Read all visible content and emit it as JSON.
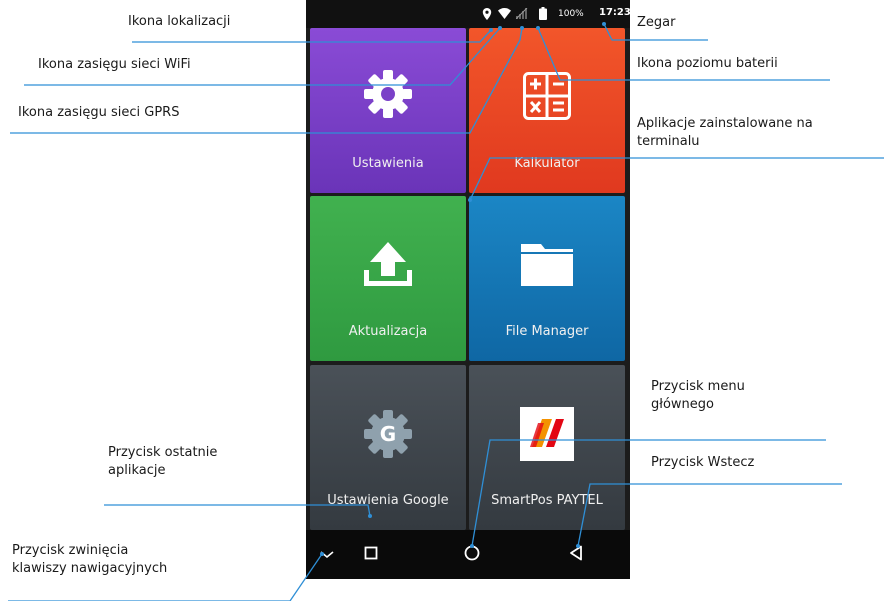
{
  "status_bar": {
    "battery_percent": "100%",
    "clock": "17:23",
    "icons": [
      "location-icon",
      "wifi-icon",
      "signal-icon",
      "battery-icon"
    ]
  },
  "apps": [
    {
      "label": "Ustawienia",
      "icon": "gear-icon",
      "color": "#7b3fc4"
    },
    {
      "label": "Kalkulator",
      "icon": "calculator-icon",
      "color": "#ee4a26"
    },
    {
      "label": "Aktualizacja",
      "icon": "upload-icon",
      "color": "#3aa548"
    },
    {
      "label": "File Manager",
      "icon": "folder-icon",
      "color": "#1677b6"
    },
    {
      "label": "Ustawienia Google",
      "icon": "google-settings-icon",
      "color": "#3a4148"
    },
    {
      "label": "SmartPos PAYTEL",
      "icon": "paytel-icon",
      "color": "#3a4148"
    }
  ],
  "nav_bar": {
    "icons": [
      "collapse-icon",
      "recents-icon",
      "home-icon",
      "back-icon"
    ]
  },
  "annotations": {
    "location": "Ikona lokalizacji",
    "wifi": "Ikona zasięgu sieci WiFi",
    "gprs": "Ikona zasięgu sieci GPRS",
    "clock": "Zegar",
    "battery": "Ikona poziomu baterii",
    "apps_line1": "Aplikacje zainstalowane na",
    "apps_line2": "terminalu",
    "home_line1": "Przycisk menu",
    "home_line2": "głównego",
    "back": "Przycisk Wstecz",
    "recents_line1": "Przycisk ostatnie",
    "recents_line2": "aplikacje",
    "collapse_line1": "Przycisk zwinięcia",
    "collapse_line2": "klawiszy nawigacyjnych"
  }
}
